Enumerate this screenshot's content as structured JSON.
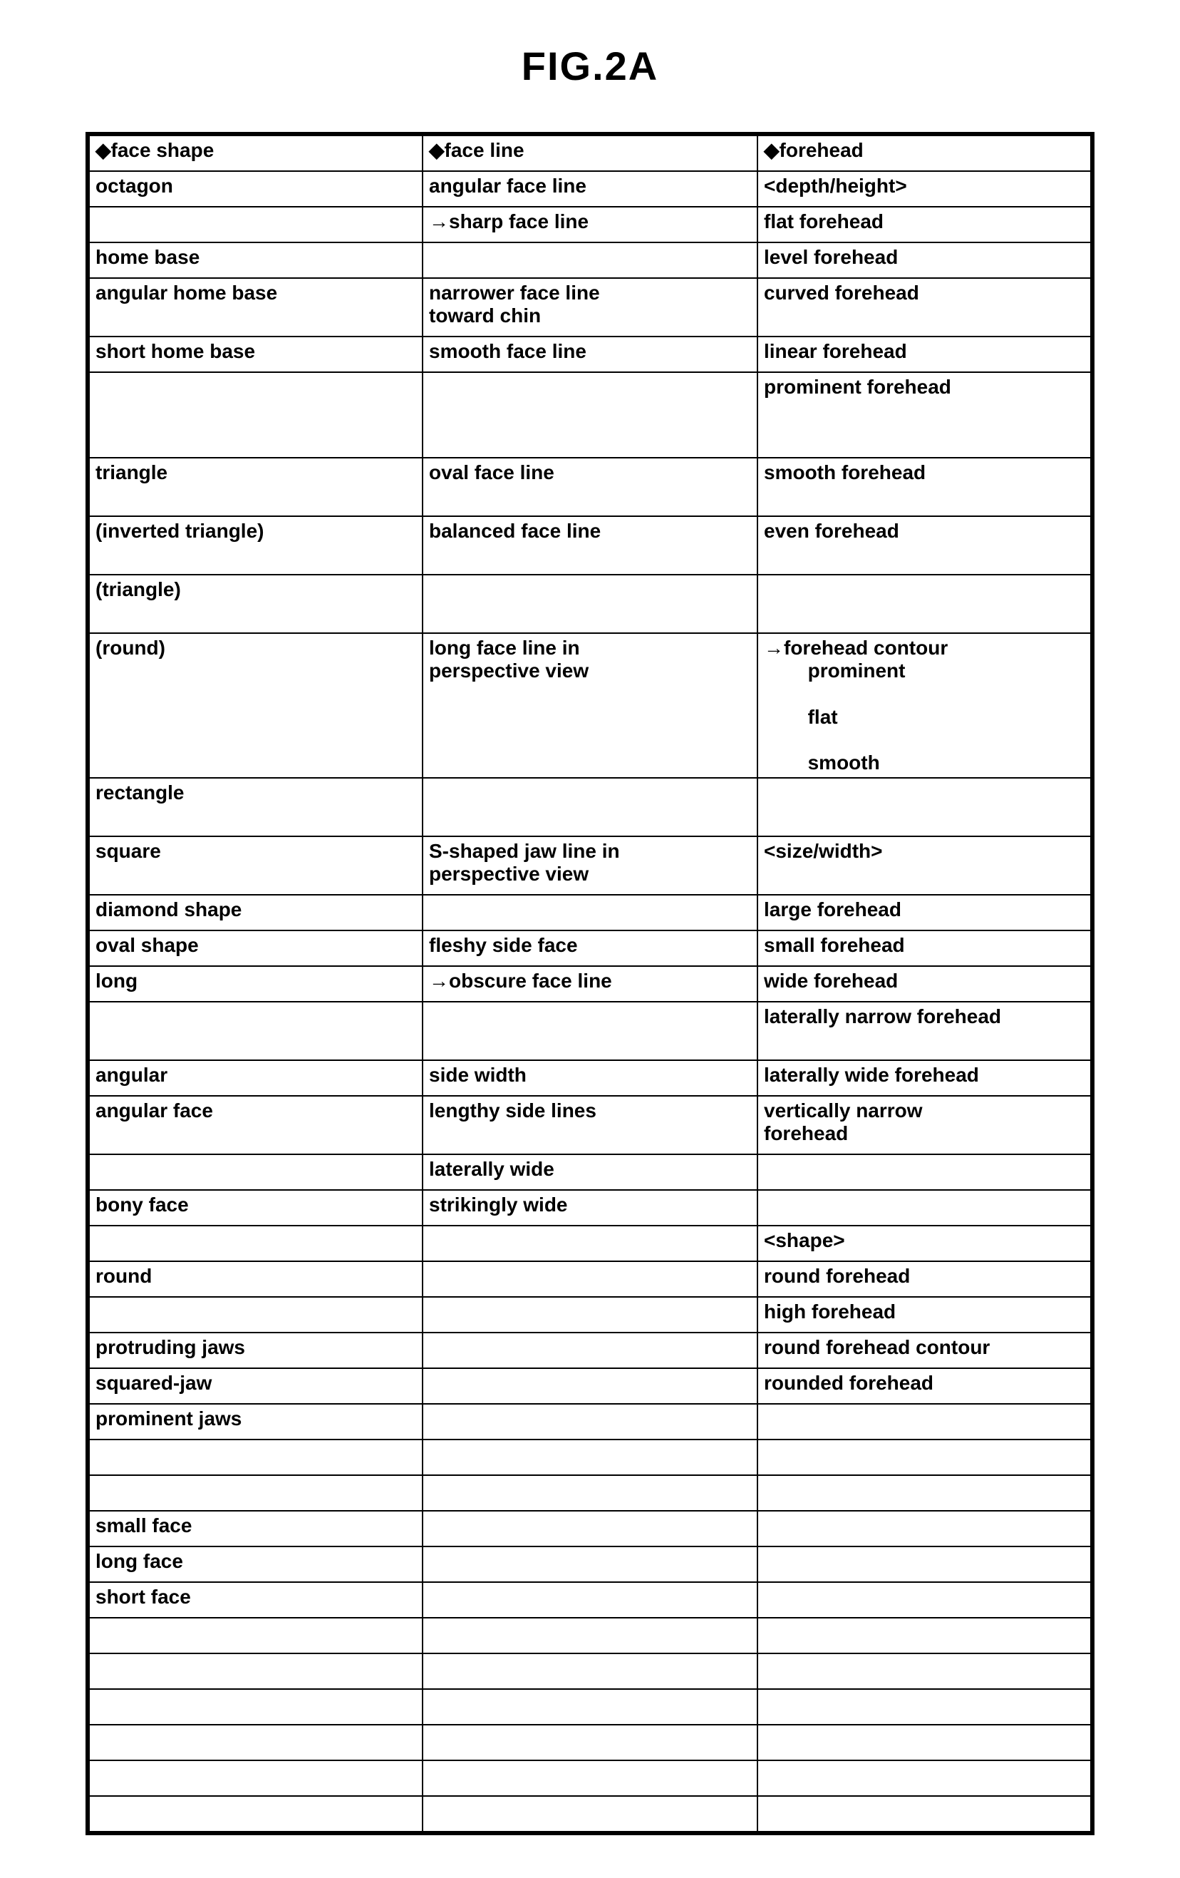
{
  "title": "FIG.2A",
  "rows": [
    {
      "c1": "◆face shape",
      "c2": "◆face line",
      "c3": "◆forehead"
    },
    {
      "c1": "octagon",
      "c2": "angular face line",
      "c3": "<depth/height>"
    },
    {
      "c1": " ",
      "c2": "→sharp face line",
      "c3": "flat forehead"
    },
    {
      "c1": "home base",
      "c2": " ",
      "c3": "level forehead"
    },
    {
      "c1": "angular home base",
      "c2": "narrower face line\ntoward chin",
      "c3": "curved forehead",
      "cls": "med"
    },
    {
      "c1": "short home base",
      "c2": "smooth face line",
      "c3": "linear forehead"
    },
    {
      "c1": " ",
      "c2": " ",
      "c3": "prominent forehead",
      "cls": "tall"
    },
    {
      "c1": "triangle",
      "c2": "oval face line",
      "c3": "smooth forehead",
      "cls": "med"
    },
    {
      "c1": "(inverted triangle)",
      "c2": "balanced face line",
      "c3": "even forehead",
      "cls": "med"
    },
    {
      "c1": "(triangle)",
      "c2": " ",
      "c3": " ",
      "cls": "med"
    },
    {
      "c1": "(round)",
      "c2": "long face line in\nperspective view",
      "c3": "→forehead contour\n   prominent\n   flat\n   smooth",
      "cls": "tall",
      "c3indent": true
    },
    {
      "c1": "rectangle",
      "c2": " ",
      "c3": " ",
      "cls": "med"
    },
    {
      "c1": "square",
      "c2": "S-shaped jaw line in\nperspective view",
      "c3": "<size/width>",
      "cls": "med"
    },
    {
      "c1": "diamond shape",
      "c2": " ",
      "c3": "large forehead"
    },
    {
      "c1": "oval shape",
      "c2": "fleshy side face",
      "c3": "small forehead"
    },
    {
      "c1": "long",
      "c2": "→obscure face line",
      "c3": "wide forehead"
    },
    {
      "c1": " ",
      "c2": " ",
      "c3": "laterally narrow forehead",
      "cls": "med"
    },
    {
      "c1": "angular",
      "c2": "side width",
      "c3": "laterally wide forehead"
    },
    {
      "c1": "angular face",
      "c2": "lengthy side lines",
      "c3": "vertically narrow\nforehead",
      "cls": "med"
    },
    {
      "c1": " ",
      "c2": "laterally wide",
      "c3": " "
    },
    {
      "c1": "bony face",
      "c2": "strikingly wide",
      "c3": " "
    },
    {
      "c1": " ",
      "c2": " ",
      "c3": "<shape>"
    },
    {
      "c1": "round",
      "c2": " ",
      "c3": "round forehead"
    },
    {
      "c1": " ",
      "c2": " ",
      "c3": "high forehead"
    },
    {
      "c1": "protruding jaws",
      "c2": " ",
      "c3": "round forehead contour"
    },
    {
      "c1": "squared-jaw",
      "c2": " ",
      "c3": "rounded forehead"
    },
    {
      "c1": "prominent jaws",
      "c2": " ",
      "c3": " "
    },
    {
      "c1": " ",
      "c2": " ",
      "c3": " "
    },
    {
      "c1": " ",
      "c2": " ",
      "c3": " "
    },
    {
      "c1": "small face",
      "c2": " ",
      "c3": " "
    },
    {
      "c1": "long face",
      "c2": " ",
      "c3": " "
    },
    {
      "c1": "short face",
      "c2": " ",
      "c3": " "
    },
    {
      "c1": " ",
      "c2": " ",
      "c3": " "
    },
    {
      "c1": " ",
      "c2": " ",
      "c3": " "
    },
    {
      "c1": " ",
      "c2": " ",
      "c3": " "
    },
    {
      "c1": " ",
      "c2": " ",
      "c3": " "
    },
    {
      "c1": " ",
      "c2": " ",
      "c3": " "
    },
    {
      "c1": " ",
      "c2": " ",
      "c3": " "
    }
  ]
}
